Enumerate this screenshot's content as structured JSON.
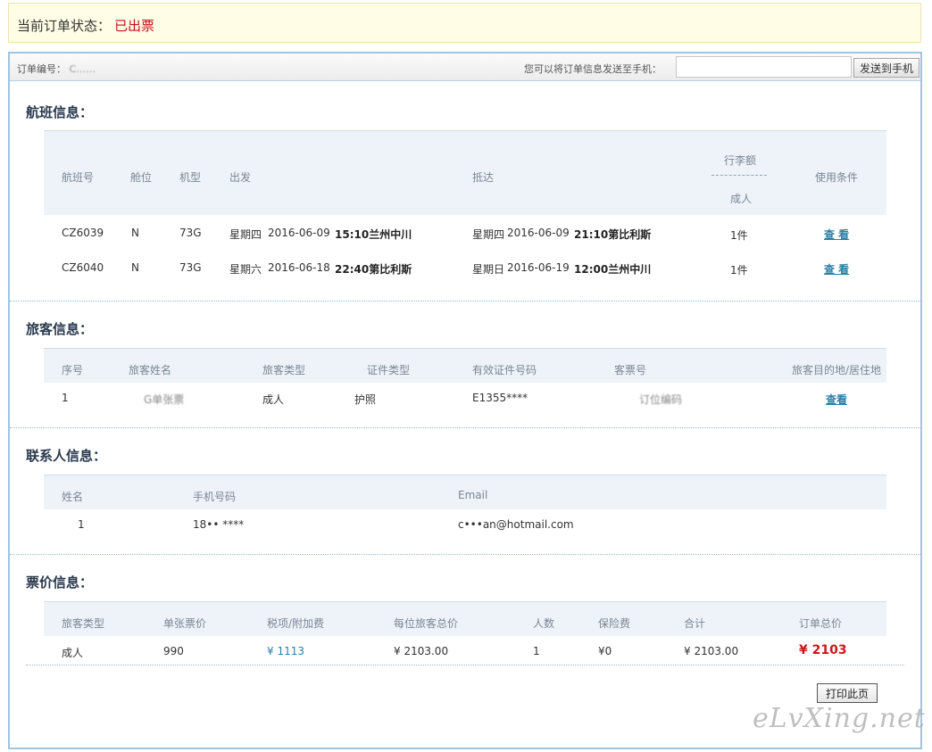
{
  "status": {
    "label": "当前订单状态：",
    "value": "已出票"
  },
  "header": {
    "order_label": "订单编号：",
    "order_value": "C……",
    "sms_label": "您可以将订单信息发送至手机：",
    "sms_placeholder": "",
    "sms_button": "发送到手机"
  },
  "flight": {
    "title": "航班信息：",
    "headers": {
      "flight_no": "航班号",
      "cabin": "舱位",
      "aircraft": "机型",
      "departure": "出发",
      "arrival": "抵达",
      "baggage": "行李额",
      "baggage_sub": "成人",
      "conditions": "使用条件"
    },
    "rows": [
      {
        "flight_no": "CZ6039",
        "cabin": "N",
        "aircraft": "73G",
        "dep_day": "星期四",
        "dep_date": "2016-06-09",
        "dep_time_place": "15:10兰州中川",
        "arr_day": "星期四",
        "arr_date": "2016-06-09",
        "arr_time_place": "21:10第比利斯",
        "baggage": "1件",
        "conditions": "查 看"
      },
      {
        "flight_no": "CZ6040",
        "cabin": "N",
        "aircraft": "73G",
        "dep_day": "星期六",
        "dep_date": "2016-06-18",
        "dep_time_place": "22:40第比利斯",
        "arr_day": "星期日",
        "arr_date": "2016-06-19",
        "arr_time_place": "12:00兰州中川",
        "baggage": "1件",
        "conditions": "查 看"
      }
    ]
  },
  "passenger": {
    "title": "旅客信息：",
    "headers": {
      "index": "序号",
      "name": "旅客姓名",
      "type": "旅客类型",
      "id_type": "证件类型",
      "id_no": "有效证件号码",
      "ticket_no": "客票号",
      "destination": "旅客目的地/居住地"
    },
    "rows": [
      {
        "index": "1",
        "name": "G单张票",
        "type": "成人",
        "id_type": "护照",
        "id_no": "E1355****",
        "ticket_no": "订位编码",
        "destination": "查看"
      }
    ]
  },
  "contact": {
    "title": "联系人信息：",
    "headers": {
      "name": "姓名",
      "phone": "手机号码",
      "email": "Email"
    },
    "rows": [
      {
        "name": "1",
        "phone": "18•• ****",
        "email": "c•••an@hotmail.com"
      }
    ]
  },
  "price": {
    "title": "票价信息：",
    "headers": {
      "type": "旅客类型",
      "fare": "单张票价",
      "tax": "税项/附加费",
      "per_total": "每位旅客总价",
      "count": "人数",
      "insurance": "保险费",
      "subtotal": "合计",
      "order_total": "订单总价"
    },
    "rows": [
      {
        "type": "成人",
        "fare": "990",
        "tax": "¥ 1113",
        "per_total": "¥ 2103.00",
        "count": "1",
        "insurance": "¥0",
        "subtotal": "¥ 2103.00",
        "order_total": "¥ 2103"
      }
    ]
  },
  "print_button": "打印此页",
  "watermark": "eLvXing.net",
  "colors": {
    "status_red": "#c0111b",
    "link_blue": "#2b7fa8",
    "frame_border": "#9fc5e1",
    "header_bg": "#eef3f9"
  }
}
